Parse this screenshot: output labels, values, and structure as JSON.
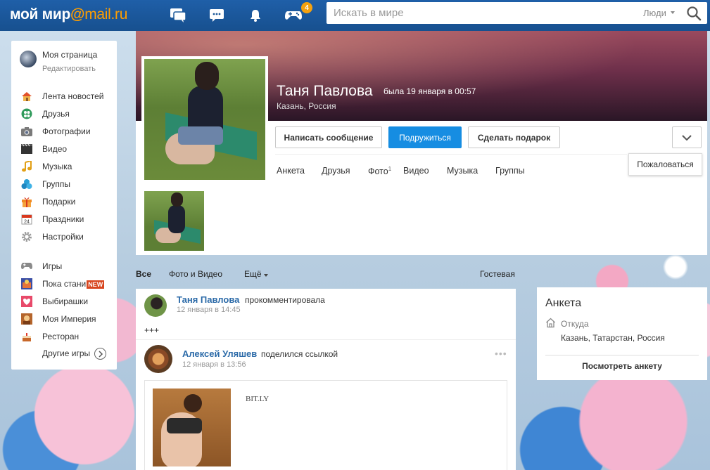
{
  "header": {
    "logo_part1": "мой мир",
    "logo_at": "@",
    "logo_part2": "mail.ru",
    "games_badge": "4",
    "search_placeholder": "Искать в мире",
    "search_scope": "Люди"
  },
  "sidebar": {
    "my_page": "Моя страница",
    "edit": "Редактировать",
    "items": [
      {
        "label": "Лента новостей",
        "icon": "home-icon"
      },
      {
        "label": "Друзья",
        "icon": "friends-icon"
      },
      {
        "label": "Фотографии",
        "icon": "camera-icon"
      },
      {
        "label": "Видео",
        "icon": "video-icon"
      },
      {
        "label": "Музыка",
        "icon": "music-icon"
      },
      {
        "label": "Группы",
        "icon": "groups-icon"
      },
      {
        "label": "Подарки",
        "icon": "gift-icon"
      },
      {
        "label": "Праздники",
        "icon": "calendar-icon"
      },
      {
        "label": "Настройки",
        "icon": "gear-icon"
      }
    ],
    "games": [
      {
        "label": "Игры",
        "icon": "gamepad-icon"
      },
      {
        "label": "Пока стани",
        "icon": "game-thumb-icon",
        "tag": "NEW"
      },
      {
        "label": "Выбирашки",
        "icon": "game-thumb-icon"
      },
      {
        "label": "Моя Империя",
        "icon": "game-thumb-icon"
      },
      {
        "label": "Ресторан",
        "icon": "game-thumb-icon"
      }
    ],
    "more_games": "Другие игры"
  },
  "profile": {
    "name": "Таня Павлова",
    "last_seen": "была 19 января в 00:57",
    "city": "Казань, Россия",
    "buttons": {
      "message": "Написать сообщение",
      "befriend": "Подружиться",
      "gift": "Сделать подарок"
    },
    "report": "Пожаловаться",
    "tabs": [
      "Анкета",
      "Друзья",
      "Фото",
      "Видео",
      "Музыка",
      "Группы"
    ],
    "photo_count": "1"
  },
  "feed_tabs": {
    "all": "Все",
    "photo_video": "Фото и Видео",
    "more": "Ещё",
    "guestbook": "Гостевая"
  },
  "feed": {
    "post1": {
      "author": "Таня Павлова",
      "action": "прокомментировала",
      "time": "12 января в 14:45",
      "text": "+++"
    },
    "post2": {
      "author": "Алексей Уляшев",
      "action": "поделился ссылкой",
      "time": "12 января в 13:56",
      "link_domain": "BIT.LY"
    }
  },
  "anketa": {
    "title": "Анкета",
    "from_label": "Откуда",
    "from_value": "Казань, Татарстан, Россия",
    "view_link": "Посмотреть анкету"
  },
  "colors": {
    "topbar": "#1f5fa8",
    "primary_button": "#168de2",
    "link": "#2b6aa8",
    "badge": "#f6a20f",
    "new_tag": "#d8461f"
  }
}
